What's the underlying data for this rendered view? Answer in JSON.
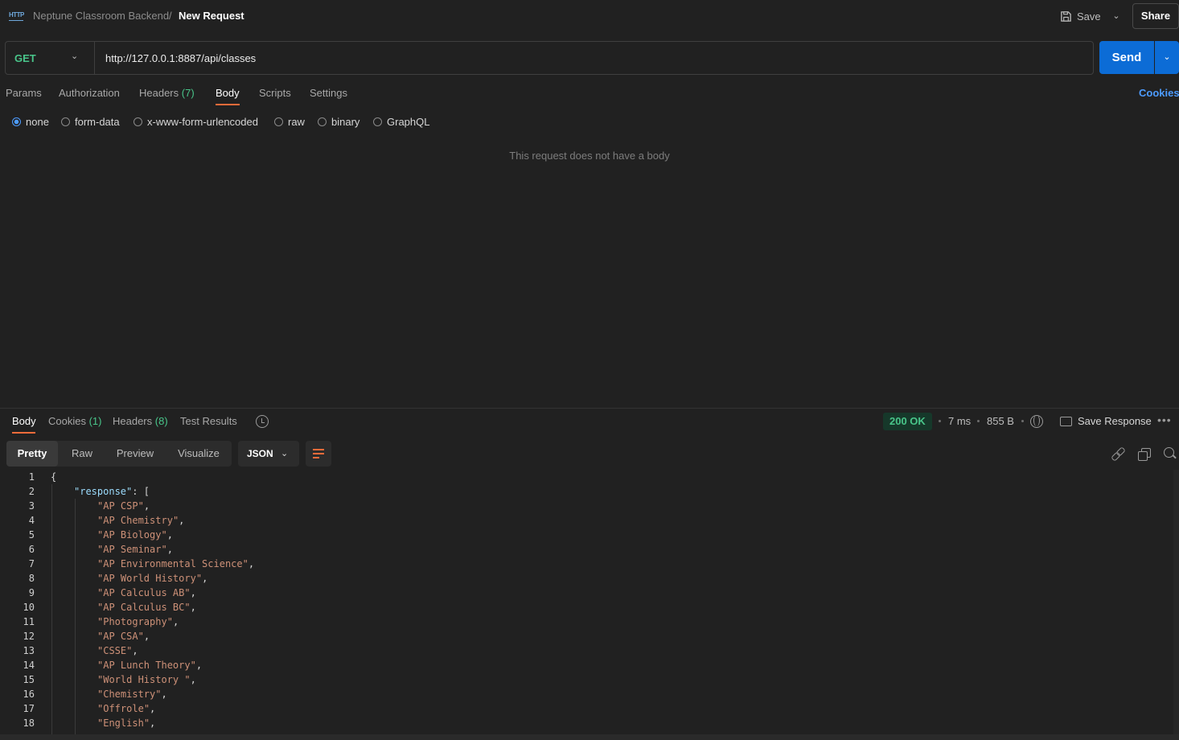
{
  "header": {
    "icon": "http-icon",
    "icon_text": "HTTP",
    "collection": "Neptune Classroom Backend",
    "separator": "/",
    "request_name": "New Request",
    "save_label": "Save",
    "share_label": "Share"
  },
  "request": {
    "method": "GET",
    "url": "http://127.0.0.1:8887/api/classes",
    "send_label": "Send",
    "tabs": [
      {
        "label": "Params"
      },
      {
        "label": "Authorization"
      },
      {
        "label": "Headers",
        "count": "(7)"
      },
      {
        "label": "Body"
      },
      {
        "label": "Scripts"
      },
      {
        "label": "Settings"
      }
    ],
    "active_tab": "Body",
    "cookies_label": "Cookies",
    "body_types": [
      "none",
      "form-data",
      "x-www-form-urlencoded",
      "raw",
      "binary",
      "GraphQL"
    ],
    "selected_body_type": "none",
    "empty_body_message": "This request does not have a body"
  },
  "response": {
    "tabs": [
      {
        "label": "Body"
      },
      {
        "label": "Cookies",
        "count": "(1)"
      },
      {
        "label": "Headers",
        "count": "(8)"
      },
      {
        "label": "Test Results"
      }
    ],
    "status": "200 OK",
    "time": "7 ms",
    "size": "855 B",
    "save_response_label": "Save Response",
    "more_label": "•••",
    "views": [
      "Pretty",
      "Raw",
      "Preview",
      "Visualize"
    ],
    "active_view": "Pretty",
    "format": "JSON",
    "body_key": "response",
    "body_values": [
      "AP CSP",
      "AP Chemistry",
      "AP Biology",
      "AP Seminar",
      "AP Environmental Science",
      "AP World History",
      "AP Calculus AB",
      "AP Calculus BC",
      "Photography",
      "AP CSA",
      "CSSE",
      "AP Lunch Theory",
      "World History ",
      "Chemistry",
      "Offrole",
      "English"
    ]
  },
  "colors": {
    "accent": "#f26b3a",
    "send": "#0c6cd6",
    "method_get": "#49c58a",
    "link": "#4d9cff",
    "json_key": "#9cdcfe",
    "json_string": "#ce9178"
  }
}
